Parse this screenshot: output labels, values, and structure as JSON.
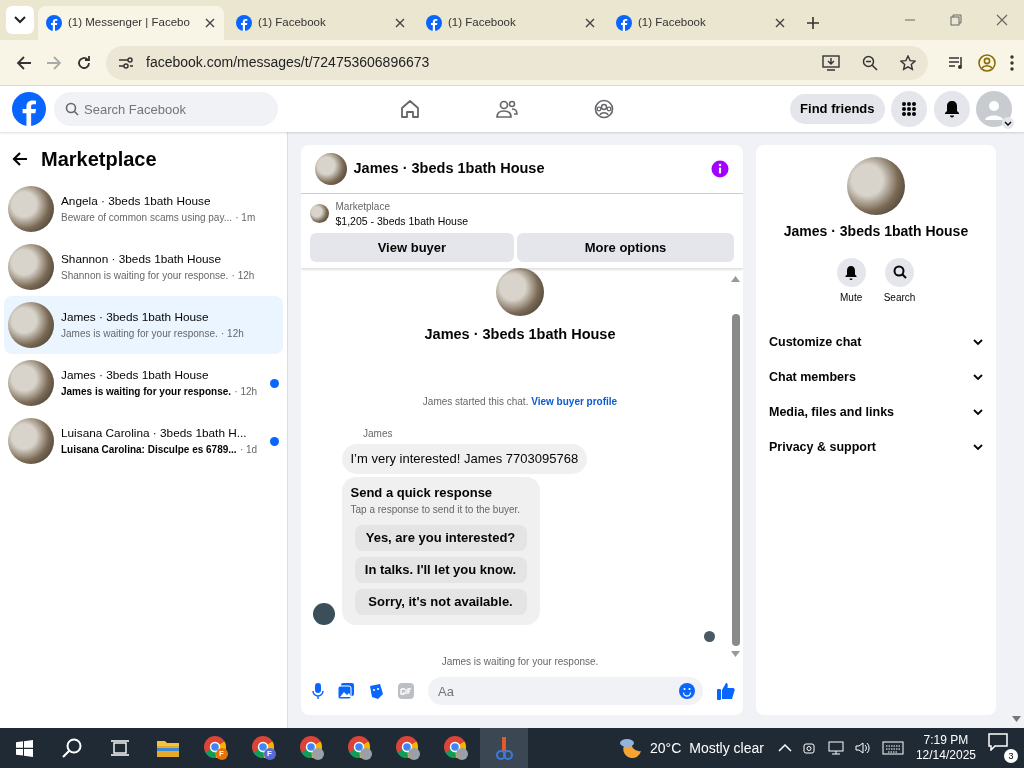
{
  "browser": {
    "tabs": [
      {
        "title": "(1) Messenger | Facebo",
        "selected": true
      },
      {
        "title": "(1) Facebook",
        "selected": false
      },
      {
        "title": "(1) Facebook",
        "selected": false
      },
      {
        "title": "(1) Facebook",
        "selected": false
      }
    ],
    "url": "facebook.com/messages/t/724753606896673"
  },
  "header": {
    "search": {
      "placeholder": "Search Facebook"
    },
    "find_friends": "Find friends"
  },
  "sidebar": {
    "title": "Marketplace",
    "conversations": [
      {
        "name": "Angela · 3beds 1bath House",
        "preview": "Beware of common scams using pay...",
        "time": "· 1m",
        "selected": false,
        "unread": false
      },
      {
        "name": "Shannon · 3beds 1bath House",
        "preview": "Shannon is waiting for your response.",
        "time": "· 12h",
        "selected": false,
        "unread": false
      },
      {
        "name": "James · 3beds 1bath House",
        "preview": "James is waiting for your response.",
        "time": "· 12h",
        "selected": true,
        "unread": false
      },
      {
        "name": "James · 3beds 1bath House",
        "preview": "James is waiting for your response.",
        "time": "· 12h",
        "selected": false,
        "unread": true
      },
      {
        "name": "Luisana Carolina · 3beds 1bath H...",
        "preview": "Luisana Carolina: Disculpe es 6789...",
        "time": "· 1d",
        "selected": false,
        "unread": true
      }
    ]
  },
  "chat": {
    "title": "James · 3beds 1bath House",
    "listing": {
      "source": "Marketplace",
      "title": "$1,205 - 3beds 1bath House"
    },
    "buttons": [
      "View buyer",
      "More options"
    ],
    "intro_name": "James · 3beds 1bath House",
    "started_text": "James started this chat.",
    "started_link": "View buyer profile",
    "sender": "James",
    "message": "I’m very interested!  James 7703095768",
    "quick_response": {
      "title": "Send a quick response",
      "subtitle": "Tap a response to send it to the buyer.",
      "options": [
        "Yes, are you interested?",
        "In talks. I'll let you know.",
        "Sorry, it's not available."
      ]
    },
    "waiting_text": "James is waiting for your response.",
    "composer": {
      "placeholder": "Aa"
    }
  },
  "info": {
    "name": "James · 3beds 1bath House",
    "actions": [
      {
        "label": "Mute",
        "kind": "bell"
      },
      {
        "label": "Search",
        "kind": "search"
      }
    ],
    "sections": [
      {
        "label": "Customize chat",
        "expanded": false
      },
      {
        "label": "Chat members",
        "expanded": false
      },
      {
        "label": "Media, files and links",
        "expanded": false
      },
      {
        "label": "Privacy & support",
        "expanded": false
      }
    ]
  },
  "taskbar": {
    "weather": {
      "temp": "20°C",
      "condition": "Mostly clear"
    },
    "apps": [
      {
        "kind": "folder"
      },
      {
        "kind": "chrome",
        "badge": "F"
      },
      {
        "kind": "chrome",
        "badge": "F"
      },
      {
        "kind": "chrome"
      },
      {
        "kind": "chrome"
      },
      {
        "kind": "chrome"
      },
      {
        "kind": "chrome"
      },
      {
        "kind": "tool"
      }
    ],
    "time": "7:19 PM",
    "date": "12/14/2025",
    "notifications": "3"
  }
}
